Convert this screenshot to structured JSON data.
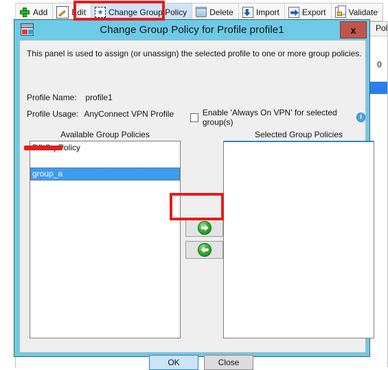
{
  "toolbar": {
    "items": [
      {
        "label": "Add",
        "icon": "plus-icon",
        "active": false
      },
      {
        "label": "Edit",
        "icon": "edit-icon",
        "active": false
      },
      {
        "label": "Change Group Policy",
        "icon": "policy-icon",
        "active": true
      },
      {
        "label": "Delete",
        "icon": "trash-icon",
        "active": false
      },
      {
        "label": "Import",
        "icon": "import-icon",
        "active": false
      },
      {
        "label": "Export",
        "icon": "export-icon",
        "active": false
      },
      {
        "label": "Validate",
        "icon": "validate-icon",
        "active": false
      }
    ]
  },
  "background_window": {
    "column_header_fragment": "Pol",
    "row_value_fragment": "0"
  },
  "dialog": {
    "title": "Change Group Policy for Profile profile1",
    "icon": "profile-window-icon",
    "close_label": "x",
    "intro": "This panel is used to assign (or unassign) the selected profile to one or more group policies.",
    "profile_name_label": "Profile Name:",
    "profile_name_value": "profile1",
    "profile_usage_label": "Profile Usage:",
    "profile_usage_value": "AnyConnect VPN Profile",
    "always_on": {
      "label": "Enable 'Always On VPN' for selected group(s)",
      "checked": false,
      "info_icon": "info-icon",
      "info_glyph": "i"
    },
    "available": {
      "caption": "Available Group Policies",
      "items": [
        {
          "label": "DfltGrpPolicy",
          "selected": false
        },
        {
          "label": "",
          "selected": false
        },
        {
          "label": "group_a",
          "selected": true
        }
      ]
    },
    "selected": {
      "caption": "Selected Group Policies",
      "items": []
    },
    "transfer": {
      "add_icon": "arrow-right-icon",
      "remove_icon": "arrow-left-icon"
    },
    "buttons": {
      "ok": "OK",
      "close": "Close"
    }
  },
  "annotations": {
    "accent_color": "#e81c1c",
    "items": [
      {
        "name": "toolbar-highlight",
        "target": "Change Group Policy"
      },
      {
        "name": "arrow-highlight",
        "target": "arrow-right-icon"
      },
      {
        "name": "group-a-underline",
        "target": "group_a"
      }
    ]
  }
}
